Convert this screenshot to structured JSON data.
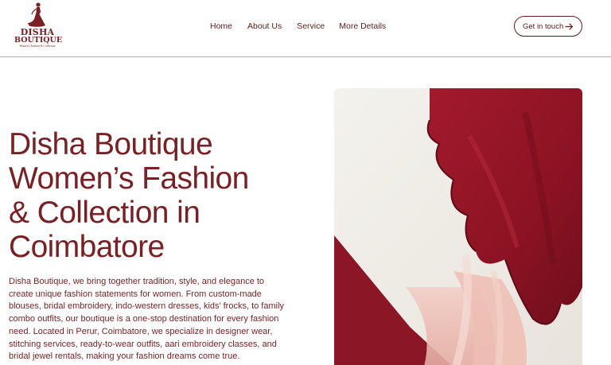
{
  "brand": {
    "name_line1": "DISHA",
    "name_line2": "BOUTIQUE",
    "tagline": "Women's Fashion & Collection",
    "color": "#7a1f24"
  },
  "nav": {
    "items": [
      {
        "label": "Home"
      },
      {
        "label": "About Us"
      },
      {
        "label": "Service"
      },
      {
        "label": "More Details"
      }
    ]
  },
  "cta": {
    "label": "Get in touch",
    "icon": "arrow-right-icon"
  },
  "hero": {
    "title_lines": [
      "Disha Boutique",
      "Women’s Fashion",
      "& Collection in",
      "Coimbatore"
    ],
    "description": "Disha Boutique, we bring together tradition, style, and elegance to create unique fashion statements for women. From custom-made blouses, bridal embroidery, indo-western dresses, kids’ frocks, to family combo outfits, our boutique is a one-stop destination for every fashion need. Located in Perur, Coimbatore, we specialize in designer wear, stitching services, ready-to-wear outfits, aari embroidery classes, and bridal jewel rentals, making your fashion dreams come true."
  },
  "colors": {
    "maroon": "#7a1f24",
    "fabric_red": "#8e1424",
    "fabric_pink": "#e9b6ad",
    "background": "#ffffff",
    "divider": "#cfa5a8"
  }
}
